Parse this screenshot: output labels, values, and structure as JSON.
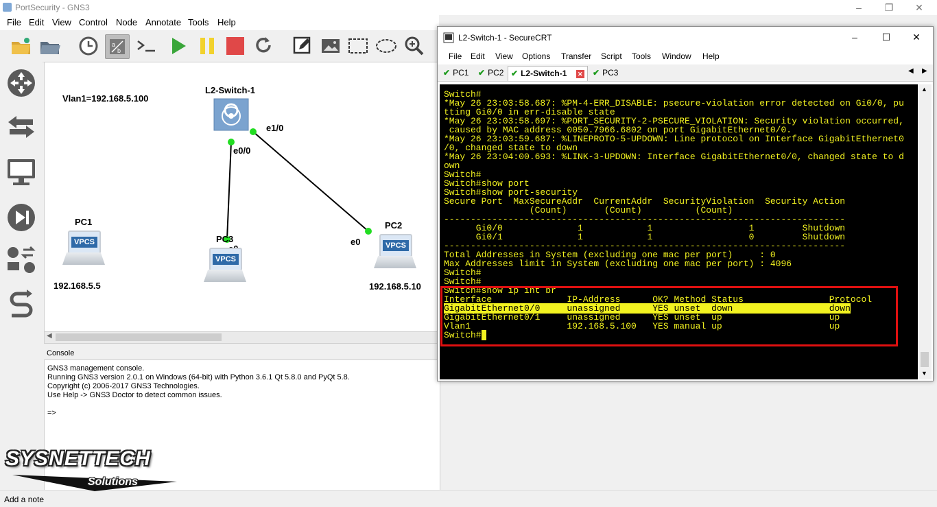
{
  "gns3": {
    "title": "PortSecurity - GNS3",
    "menu": [
      "File",
      "Edit",
      "View",
      "Control",
      "Node",
      "Annotate",
      "Tools",
      "Help"
    ],
    "console_title": "Console",
    "console_lines": [
      "GNS3 management console.",
      "Running GNS3 version 2.0.1 on Windows (64-bit) with Python 3.6.1 Qt 5.8.0 and PyQt 5.8.",
      "Copyright (c) 2006-2017 GNS3 Technologies.",
      "Use Help -> GNS3 Doctor to detect common issues.",
      "",
      "=>"
    ],
    "status": "Add a note",
    "topology": {
      "vlan_note": "Vlan1=192.168.5.100",
      "switch_label": "L2-Switch-1",
      "pc1_label": "PC1",
      "pc1_ip": "192.168.5.5",
      "pc2_label": "PC2",
      "pc2_ip": "192.168.5.10",
      "pc3_label": "PC3",
      "port_e1_0": "e1/0",
      "port_e0_0": "e0/0",
      "port_pc3_e0": "e0",
      "port_pc2_e0": "e0",
      "vpcs_text": "VPCS"
    }
  },
  "securecrt": {
    "title": "L2-Switch-1 - SecureCRT",
    "menu": [
      "File",
      "Edit",
      "View",
      "Options",
      "Transfer",
      "Script",
      "Tools",
      "Window",
      "Help"
    ],
    "tabs": [
      {
        "label": "PC1",
        "active": false
      },
      {
        "label": "PC2",
        "active": false
      },
      {
        "label": "L2-Switch-1",
        "active": true
      },
      {
        "label": "PC3",
        "active": false
      }
    ],
    "terminal_lines": [
      "Switch#",
      "*May 26 23:03:58.687: %PM-4-ERR_DISABLE: psecure-violation error detected on Gi0/0, pu",
      "tting Gi0/0 in err-disable state",
      "*May 26 23:03:58.697: %PORT_SECURITY-2-PSECURE_VIOLATION: Security violation occurred,",
      " caused by MAC address 0050.7966.6802 on port GigabitEthernet0/0.",
      "*May 26 23:03:59.687: %LINEPROTO-5-UPDOWN: Line protocol on Interface GigabitEthernet0",
      "/0, changed state to down",
      "*May 26 23:04:00.693: %LINK-3-UPDOWN: Interface GigabitEthernet0/0, changed state to d",
      "own",
      "Switch#",
      "Switch#show port",
      "Switch#show port-security",
      "Secure Port  MaxSecureAddr  CurrentAddr  SecurityViolation  Security Action",
      "                (Count)       (Count)          (Count)",
      "---------------------------------------------------------------------------",
      "      Gi0/0              1            1                  1         Shutdown",
      "      Gi0/1              1            1                  0         Shutdown",
      "---------------------------------------------------------------------------",
      "Total Addresses in System (excluding one mac per port)     : 0",
      "Max Addresses limit in System (excluding one mac per port) : 4096",
      "Switch#",
      "Switch#",
      "Switch#show ip int br",
      "Interface              IP-Address      OK? Method Status                Protocol",
      "GigabitEthernet0/0     unassigned      YES unset  down                  down",
      "GigabitEthernet0/1     unassigned      YES unset  up                    up",
      "Vlan1                  192.168.5.100   YES manual up                    up",
      "Switch#"
    ],
    "highlight_line_index": 24
  },
  "watermark": {
    "brand": "SYSNETTECH",
    "sub": "Solutions"
  },
  "colors": {
    "terminal_bg": "#000000",
    "terminal_fg": "#f2f220",
    "highlight_box": "#e01010",
    "link_dot": "#22dd22"
  }
}
